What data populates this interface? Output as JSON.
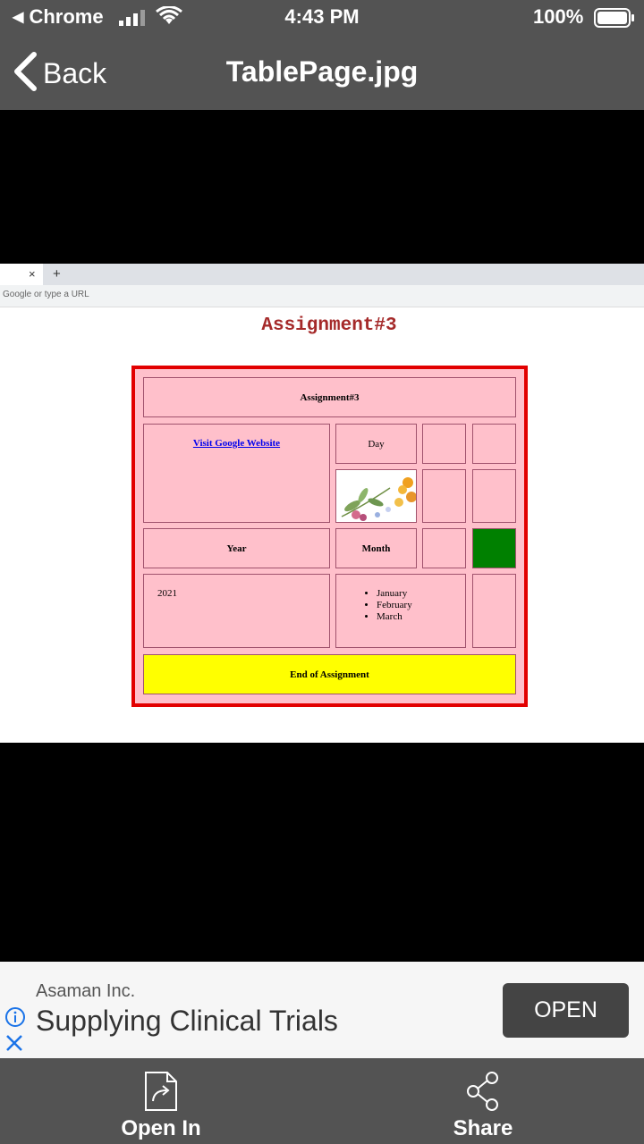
{
  "status_bar": {
    "carrier": "Chrome",
    "time": "4:43 PM",
    "battery_pct": "100%"
  },
  "nav": {
    "back_label": "Back",
    "title": "TablePage.jpg"
  },
  "screenshot": {
    "tab_close": "×",
    "tab_new": "+",
    "url_placeholder": "Google or type a URL",
    "page_heading": "Assignment#3",
    "table": {
      "header": "Assignment#3",
      "link_text": "Visit Google Website",
      "day_label": "Day",
      "year_label": "Year",
      "month_label": "Month",
      "year_value": "2021",
      "months": [
        "January",
        "February",
        "March"
      ],
      "footer": "End of Assignment",
      "colors": {
        "border": "#e20000",
        "cell_bg": "#ffc0cb",
        "green_cell": "#008000",
        "footer_bg": "#ffff00"
      }
    }
  },
  "ad": {
    "advertiser": "Asaman Inc.",
    "headline": "Supplying Clinical Trials",
    "cta": "OPEN"
  },
  "toolbar": {
    "open_in_label": "Open In",
    "share_label": "Share"
  }
}
